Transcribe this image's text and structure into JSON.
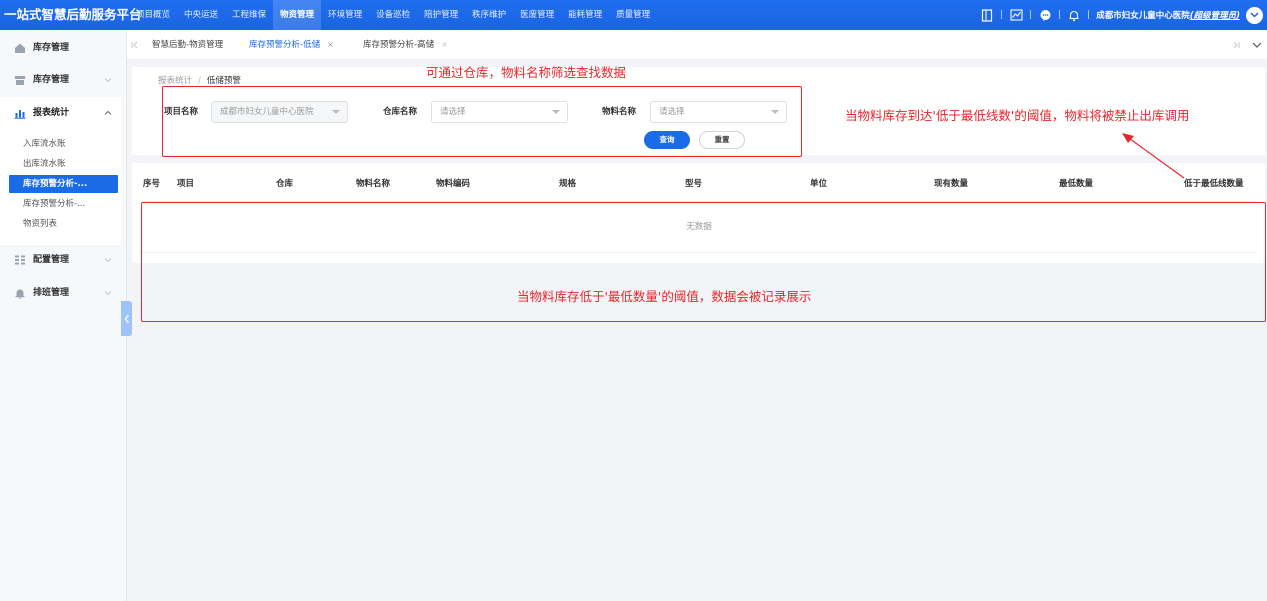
{
  "app": {
    "brand": "一站式智慧后勤服务平台",
    "nav": [
      "项目概览",
      "中央运送",
      "工程维保",
      "物资管理",
      "环境管理",
      "设备巡检",
      "陪护管理",
      "秩序维护",
      "医废管理",
      "能耗管理",
      "质量管理"
    ],
    "active_nav": "物资管理",
    "user_org": "成都市妇女儿童中心医院",
    "user_role": "(超级管理员)",
    "separator": "|"
  },
  "sidebar": {
    "groups": [
      {
        "label": "库存管理",
        "icon": "home-icon"
      },
      {
        "label": "库存管理",
        "icon": "box-icon"
      },
      {
        "label": "报表统计",
        "icon": "bar-chart-icon"
      },
      {
        "label": "配置管理",
        "icon": "grid-icon"
      },
      {
        "label": "排班管理",
        "icon": "bell-icon"
      }
    ],
    "sub_items": [
      "入库流水账",
      "出库流水账",
      "库存预警分析-...",
      "库存预警分析-...",
      "物资列表"
    ],
    "active_sub": 2
  },
  "tabs": [
    {
      "label": "智慧后勤-物资管理"
    },
    {
      "label": "库存预警分析-低储",
      "close": "×"
    },
    {
      "label": "库存预警分析-高储",
      "close": "×"
    }
  ],
  "breadcrumb": {
    "parent": "报表统计",
    "sep": "/",
    "current": "低储预警"
  },
  "filters": {
    "project": {
      "label": "项目名称",
      "value": "成都市妇女儿童中心医院"
    },
    "warehouse": {
      "label": "仓库名称",
      "placeholder": "请选择"
    },
    "material": {
      "label": "物料名称",
      "placeholder": "请选择"
    },
    "query_btn": "查询",
    "reset_btn": "重置"
  },
  "table": {
    "columns": [
      "序号",
      "项目",
      "仓库",
      "物料名称",
      "物料编码",
      "规格",
      "型号",
      "单位",
      "现有数量",
      "最低数量",
      "低于最低线数量"
    ],
    "empty_text": "无数据"
  },
  "annotations": {
    "filter_note": "可通过仓库，物料名称筛选查找数据",
    "threshold_note": "当物料库存到达'低于最低线数'的阈值，物料将被禁止出库调用",
    "table_note": "当物料库存低于'最低数量'的阈值，数据会被记录展示"
  },
  "colors": {
    "primary": "#1a6be6",
    "annotation": "#e8262b"
  }
}
